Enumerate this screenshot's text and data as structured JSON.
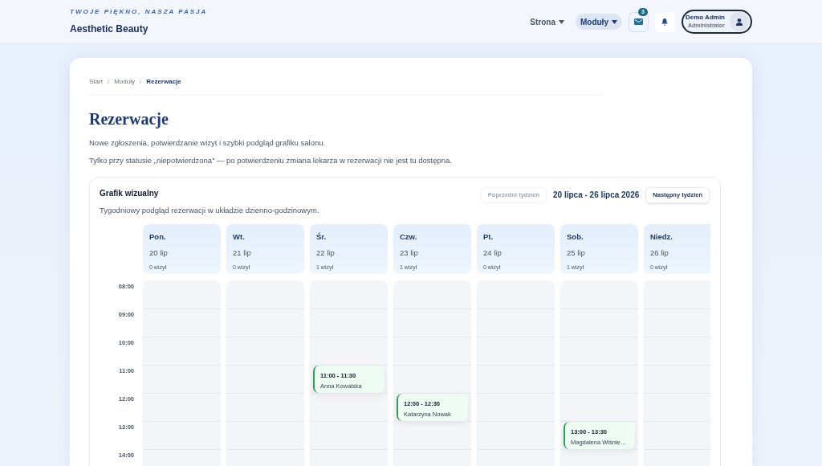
{
  "brand": {
    "tagline": "TWOJE PIĘKNO, NASZA PASJA",
    "name": "Aesthetic Beauty"
  },
  "nav": [
    {
      "label": "Strona",
      "selected": false
    },
    {
      "label": "Moduły",
      "selected": true
    }
  ],
  "messages_badge": "3",
  "user": {
    "name": "Demo Admin",
    "role": "Administrator"
  },
  "breadcrumbs": [
    "Start",
    "/",
    "Moduły",
    "/",
    "Rezerwacje"
  ],
  "page": {
    "title": "Rezerwacje",
    "description": "Nowe zgłoszenia, potwierdzanie wizyt i szybki podgląd grafiku salonu.",
    "note": "Tylko przy statusie „niepotwierdzona” — po potwierdzeniu zmiana lekarza w rezerwacji nie jest tu dostępna."
  },
  "schedule": {
    "title": "Grafik wizualny",
    "subtitle": "Tygodniowy podgląd rezerwacji w układzie dzienno-godzinowym.",
    "prev_button": {
      "label": "Poprzedni tydzień",
      "disabled": true
    },
    "range": "20 lipca - 26 lipca 2026",
    "next_button": {
      "label": "Następny tydzień",
      "disabled": false
    },
    "hours": [
      "08:00",
      "09:00",
      "10:00",
      "11:00",
      "12:00",
      "13:00",
      "14:00"
    ],
    "days": [
      {
        "name": "Pon.",
        "date": "20 lip",
        "count": "0 wizyt",
        "slots": [
          {
            "kind": "free"
          },
          {
            "kind": "free"
          },
          {
            "kind": "free"
          },
          {
            "kind": "free"
          },
          {
            "kind": "free"
          },
          {
            "kind": "free"
          },
          {
            "kind": "free"
          }
        ]
      },
      {
        "name": "Wt.",
        "date": "21 lip",
        "count": "0 wizyt",
        "slots": [
          {
            "kind": "free"
          },
          {
            "kind": "free"
          },
          {
            "kind": "free"
          },
          {
            "kind": "free"
          },
          {
            "kind": "free"
          },
          {
            "kind": "free"
          },
          {
            "kind": "free"
          }
        ]
      },
      {
        "name": "Śr.",
        "date": "22 lip",
        "count": "1 wizyt",
        "slots": [
          {
            "kind": "free"
          },
          {
            "kind": "free"
          },
          {
            "kind": "free"
          },
          {
            "kind": "booking",
            "time": "11:00 - 11:30",
            "client": "Anna Kowalska"
          },
          {
            "kind": "free"
          },
          {
            "kind": "free"
          },
          {
            "kind": "free"
          }
        ]
      },
      {
        "name": "Czw.",
        "date": "23 lip",
        "count": "1 wizyt",
        "slots": [
          {
            "kind": "free"
          },
          {
            "kind": "free"
          },
          {
            "kind": "free"
          },
          {
            "kind": "free"
          },
          {
            "kind": "booking",
            "time": "12:00 - 12:30",
            "client": "Katarzyna Nowak"
          },
          {
            "kind": "free"
          },
          {
            "kind": "free"
          }
        ]
      },
      {
        "name": "Pt.",
        "date": "24 lip",
        "count": "0 wizyt",
        "slots": [
          {
            "kind": "free"
          },
          {
            "kind": "free"
          },
          {
            "kind": "free"
          },
          {
            "kind": "free"
          },
          {
            "kind": "free"
          },
          {
            "kind": "free"
          },
          {
            "kind": "free"
          }
        ]
      },
      {
        "name": "Sob.",
        "date": "25 lip",
        "count": "1 wizyt",
        "slots": [
          {
            "kind": "free"
          },
          {
            "kind": "free"
          },
          {
            "kind": "free"
          },
          {
            "kind": "free"
          },
          {
            "kind": "free"
          },
          {
            "kind": "booking",
            "time": "13:00 - 13:30",
            "client": "Magdalena Wiśnie…"
          },
          {
            "kind": "free"
          }
        ]
      },
      {
        "name": "Niedz.",
        "date": "26 lip",
        "count": "0 wizyt",
        "slots": [
          {
            "kind": "free"
          },
          {
            "kind": "free"
          },
          {
            "kind": "free"
          },
          {
            "kind": "free"
          },
          {
            "kind": "free"
          },
          {
            "kind": "free"
          },
          {
            "kind": "free"
          }
        ]
      }
    ]
  }
}
